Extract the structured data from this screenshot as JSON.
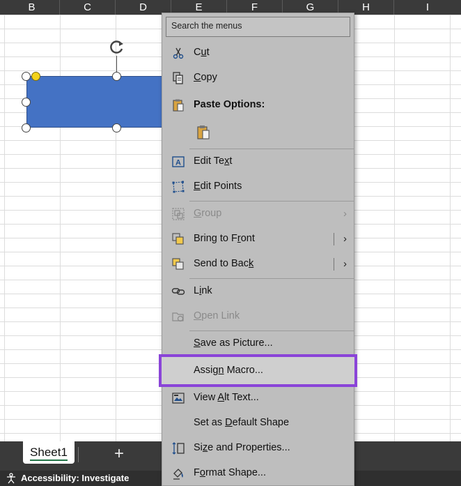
{
  "columns": [
    "B",
    "C",
    "D",
    "E",
    "F",
    "G",
    "H",
    "I"
  ],
  "search": {
    "placeholder": "Search the menus"
  },
  "menu": {
    "items": [
      {
        "pre": "C",
        "acc": "u",
        "post": "t"
      },
      {
        "pre": "",
        "acc": "C",
        "post": "opy"
      },
      {
        "pre": "Paste Options:",
        "acc": "",
        "post": ""
      },
      {
        "pre": "Edit Te",
        "acc": "x",
        "post": "t"
      },
      {
        "pre": "",
        "acc": "E",
        "post": "dit Points"
      },
      {
        "pre": "",
        "acc": "G",
        "post": "roup"
      },
      {
        "pre": "Bring to F",
        "acc": "r",
        "post": "ont"
      },
      {
        "pre": "Send to Bac",
        "acc": "k",
        "post": ""
      },
      {
        "pre": "L",
        "acc": "i",
        "post": "nk"
      },
      {
        "pre": "",
        "acc": "O",
        "post": "pen Link"
      },
      {
        "pre": "",
        "acc": "S",
        "post": "ave as Picture..."
      },
      {
        "pre": "Assig",
        "acc": "n",
        "post": " Macro..."
      },
      {
        "pre": "View ",
        "acc": "A",
        "post": "lt Text..."
      },
      {
        "pre": "Set as ",
        "acc": "D",
        "post": "efault Shape"
      },
      {
        "pre": "Si",
        "acc": "z",
        "post": "e and Properties..."
      },
      {
        "pre": "F",
        "acc": "o",
        "post": "rmat Shape..."
      }
    ]
  },
  "sheet": {
    "tab_label": "Sheet1",
    "add_label": "+"
  },
  "status": {
    "label": "Accessibility: Investigate"
  },
  "colors": {
    "shape_fill": "#4472c4",
    "highlight": "#8a44d8",
    "menu_bg": "#bebebe"
  }
}
